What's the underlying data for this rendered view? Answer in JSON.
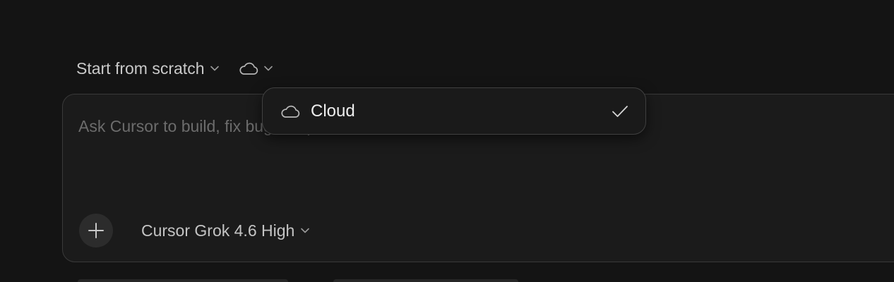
{
  "composer": {
    "template_label": "Start from scratch",
    "environment_icon": "cloud-icon",
    "prompt_placeholder": "Ask Cursor to build, fix bugs, explore",
    "add_icon": "plus-icon",
    "model_label": "Cursor Grok 4.6 High"
  },
  "environment_menu": {
    "items": [
      {
        "label": "Cloud",
        "icon": "cloud-icon",
        "selected": true
      }
    ]
  },
  "colors": {
    "background": "#141414",
    "panel": "#1b1b1b",
    "border": "#3a3a3a",
    "text": "#c9c9c9",
    "placeholder": "#6c6c6c"
  }
}
